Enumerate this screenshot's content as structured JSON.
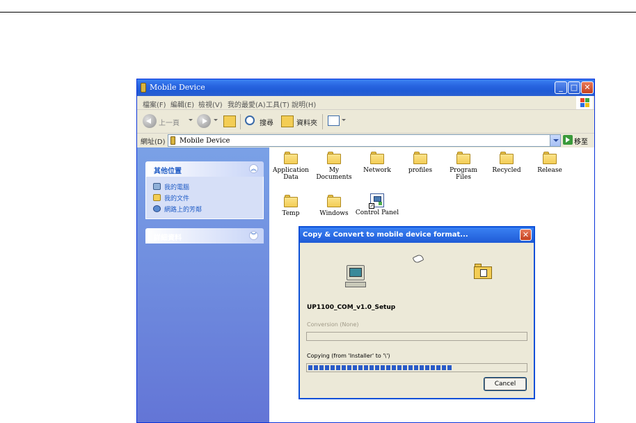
{
  "window": {
    "title": "Mobile Device",
    "menu": [
      "檔案(F)",
      "編輯(E)",
      "檢視(V)",
      "我的最愛(A)",
      "工具(T)",
      "說明(H)"
    ],
    "toolbar": {
      "back": "上一頁",
      "search": "搜尋",
      "folders": "資料夾"
    },
    "address": {
      "label": "網址(D)",
      "value": "Mobile Device",
      "go": "移至"
    }
  },
  "sidebar": {
    "other_places": {
      "title": "其他位置",
      "items": [
        "我的電腦",
        "我的文件",
        "網路上的芳鄰"
      ]
    },
    "details": {
      "title": "詳細資料"
    }
  },
  "items": [
    {
      "label": "Application\nData",
      "type": "folder"
    },
    {
      "label": "My Documents",
      "type": "folder"
    },
    {
      "label": "Network",
      "type": "folder"
    },
    {
      "label": "profiles",
      "type": "folder"
    },
    {
      "label": "Program Files",
      "type": "folder"
    },
    {
      "label": "Recycled",
      "type": "folder"
    },
    {
      "label": "Release",
      "type": "folder"
    },
    {
      "label": "Temp",
      "type": "folder"
    },
    {
      "label": "Windows",
      "type": "folder"
    },
    {
      "label": "Control Panel",
      "type": "shortcut"
    }
  ],
  "dialog": {
    "title": "Copy & Convert to mobile device format...",
    "filename": "UP1100_COM_v1.0_Setup",
    "conversion_label": "Conversion (None)",
    "copying_label": "Copying (from 'Installer' to '\\')",
    "copy_progress": 0.66,
    "cancel": "Cancel"
  },
  "colors": {
    "title_blue": "#2864e0",
    "sidebar_blue": "#6375d6",
    "folder_yellow": "#f3cd55",
    "progress_blue": "#2a5bc8"
  }
}
